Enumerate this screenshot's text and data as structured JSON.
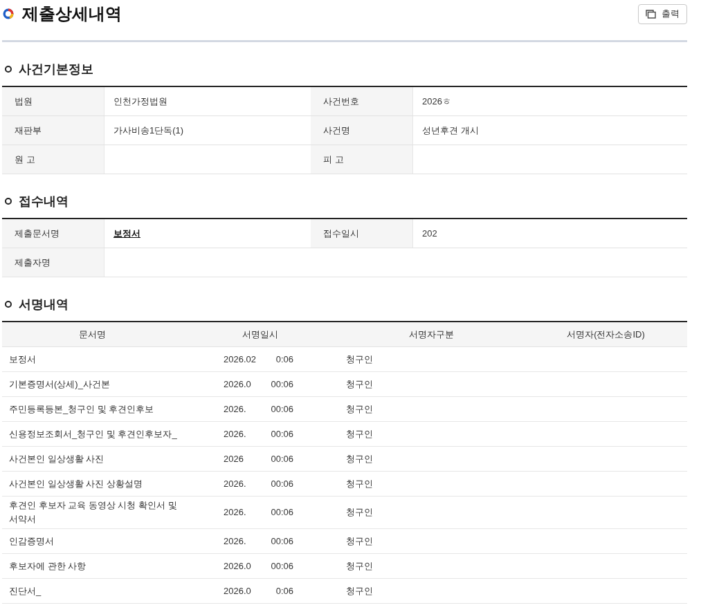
{
  "page": {
    "title": "제출상세내역",
    "print_button": "출력"
  },
  "case_info": {
    "heading": "사건기본정보",
    "rows": [
      [
        {
          "label": "법원",
          "value": "인천가정법원"
        },
        {
          "label": "사건번호",
          "value": "2026ㅎ"
        }
      ],
      [
        {
          "label": "재판부",
          "value": "가사비송1단독(1)"
        },
        {
          "label": "사건명",
          "value": "성년후견 개시"
        }
      ],
      [
        {
          "label": "원 고"
        },
        {
          "label": "피 고"
        }
      ]
    ]
  },
  "receipt": {
    "heading": "접수내역",
    "rows": [
      [
        {
          "label": "제출문서명",
          "value": "보정서",
          "kind": "link"
        },
        {
          "label": "접수일시",
          "value": "202",
          "kind": "text"
        }
      ],
      [
        {
          "label": "제출자명"
        }
      ]
    ]
  },
  "signatures": {
    "heading": "서명내역",
    "columns": [
      "문서명",
      "서명일시",
      "서명자구분",
      "서명자(전자소송ID)"
    ],
    "rows": [
      {
        "document": "보정서",
        "date": "2026.02",
        "time": "0:06",
        "role": "청구인"
      },
      {
        "document": "기본증명서(상세)_사건본",
        "date": "2026.0",
        "time": "00:06",
        "role": "청구인"
      },
      {
        "document": "주민등록등본_청구인 및 후견인후보",
        "date": "2026.",
        "time": "00:06",
        "role": "청구인"
      },
      {
        "document": "신용정보조회서_청구인 및 후견인후보자_",
        "date": "2026.",
        "time": "00:06",
        "role": "청구인"
      },
      {
        "document": "사건본인 일상생활 사진",
        "date": "2026",
        "time": "00:06",
        "role": "청구인"
      },
      {
        "document": "사건본인 일상생활 사진 상황설명",
        "date": "2026.",
        "time": "00:06",
        "role": "청구인"
      },
      {
        "document": "후견인 후보자 교육 동영상 시청 확인서 및 서약서",
        "date": "2026.",
        "time": "00:06",
        "role": "청구인"
      },
      {
        "document": "인감증명서",
        "date": "2026.",
        "time": "00:06",
        "role": "청구인"
      },
      {
        "document": "후보자에 관한 사항",
        "date": "2026.0",
        "time": "00:06",
        "role": "청구인"
      },
      {
        "document": "진단서_",
        "date": "2026.0",
        "time": "0:06",
        "role": "청구인"
      }
    ]
  }
}
